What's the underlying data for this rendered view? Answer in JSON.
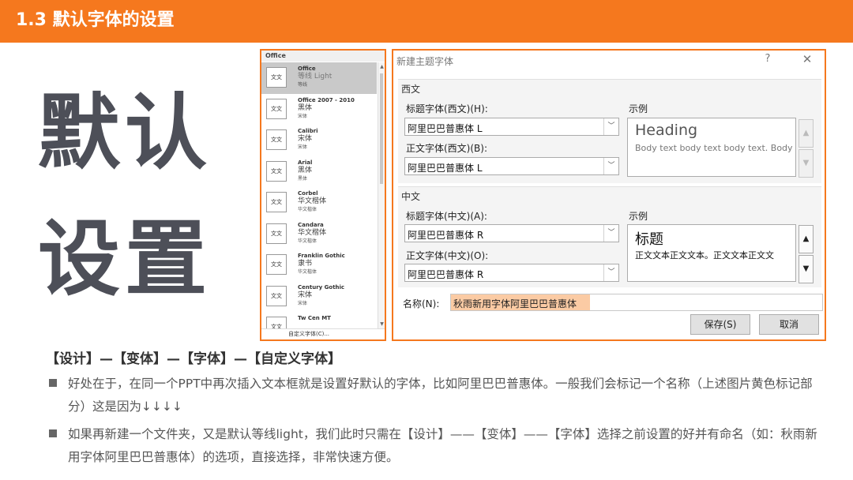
{
  "header": {
    "title": "1.3 默认字体的设置",
    "color": "#f5781e"
  },
  "big_title": {
    "line1": "默认",
    "line2": "设置"
  },
  "font_panel": {
    "header": "Office",
    "thumb_text": "文文",
    "items": [
      {
        "name": "Office",
        "heading": "等线 Light",
        "body": "等线",
        "selected": true
      },
      {
        "name": "Office 2007 - 2010",
        "heading": "黑体",
        "body": "宋体",
        "selected": false
      },
      {
        "name": "Calibri",
        "heading": "宋体",
        "body": "宋体",
        "selected": false
      },
      {
        "name": "Arial",
        "heading": "黑体",
        "body": "黑体",
        "selected": false
      },
      {
        "name": "Corbel",
        "heading": "华文楷体",
        "body": "华文楷体",
        "selected": false
      },
      {
        "name": "Candara",
        "heading": "华文楷体",
        "body": "华文楷体",
        "selected": false
      },
      {
        "name": "Franklin Gothic",
        "heading": "隶书",
        "body": "华文楷体",
        "selected": false
      },
      {
        "name": "Century Gothic",
        "heading": "宋体",
        "body": "宋体",
        "selected": false
      },
      {
        "name": "Tw Cen MT",
        "heading": "",
        "body": "",
        "selected": false
      }
    ],
    "footer": "自定义字体(C)..."
  },
  "dialog": {
    "title": "新建主题字体",
    "help_icon": "?",
    "close_icon": "✕",
    "west": {
      "group_label": "西文",
      "heading_label": "标题字体(西文)(H):",
      "heading_value": "阿里巴巴普惠体 L",
      "body_label": "正文字体(西文)(B):",
      "body_value": "阿里巴巴普惠体 L",
      "sample_label": "示例",
      "sample_heading": "Heading",
      "sample_body": "Body text body text body text. Body"
    },
    "china": {
      "group_label": "中文",
      "heading_label": "标题字体(中文)(A):",
      "heading_value": "阿里巴巴普惠体 R",
      "body_label": "正文字体(中文)(O):",
      "body_value": "阿里巴巴普惠体 R",
      "sample_label": "示例",
      "sample_heading": "标题",
      "sample_body": "正文文本正文文本。正文文本正文文"
    },
    "name_label": "名称(N):",
    "name_value": "秋雨新用字体阿里巴巴普惠体",
    "save_label": "保存(S)",
    "cancel_label": "取消"
  },
  "notes": {
    "path": "【设计】—【变体】—【字体】—【自定义字体】",
    "bullet1": "好处在于，在同一个PPT中再次插入文本框就是设置好默认的字体，比如阿里巴巴普惠体。一般我们会标记一个名称（上述图片黄色标记部分）这是因为↓↓↓↓",
    "bullet2": "如果再新建一个文件夹，又是默认等线light，我们此时只需在【设计】——【变体】——【字体】选择之前设置的好并有命名（如：秋雨新用字体阿里巴巴普惠体）的选项，直接选择，非常快速方便。"
  }
}
